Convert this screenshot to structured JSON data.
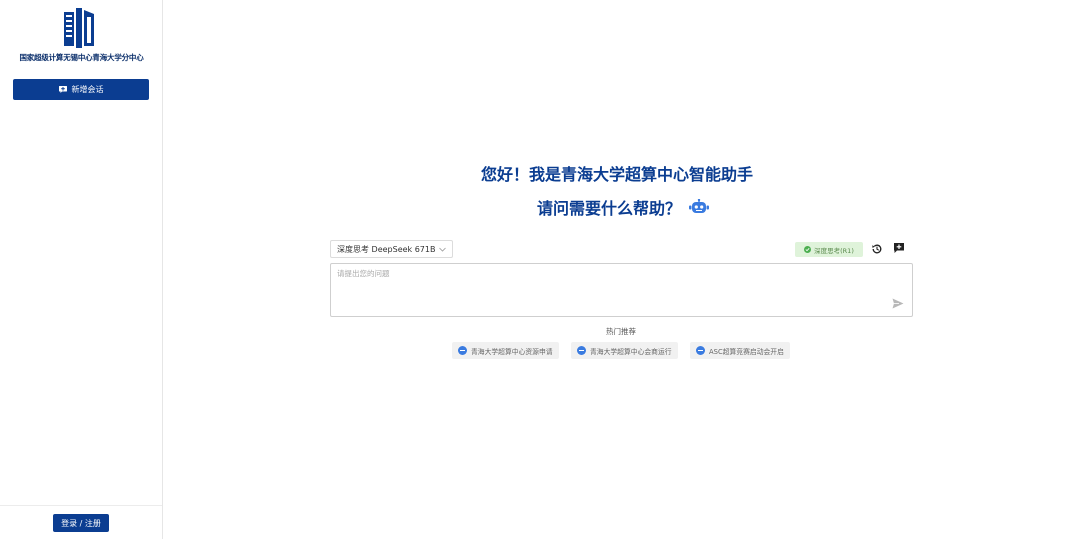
{
  "sidebar": {
    "org_name": "国家超级计算无锡中心青海大学分中心",
    "new_chat_label": "新增会话",
    "login_label": "登录 / 注册"
  },
  "welcome": {
    "line1": "您好！我是青海大学超算中心智能助手",
    "line2": "请问需要什么帮助？"
  },
  "composer": {
    "model_selected": "深度思考 DeepSeek 671B",
    "deep_think_label": "深度思考(R1)",
    "placeholder": "请提出您的问题"
  },
  "hot": {
    "title": "热门推荐",
    "items": [
      {
        "label": "青海大学超算中心资源申请"
      },
      {
        "label": "青海大学超算中心会商运行"
      },
      {
        "label": "ASC超算竞赛启动会开启"
      }
    ]
  },
  "colors": {
    "brand": "#0b3d91",
    "deep_think_bg": "#dff3da",
    "chip_bg": "#f1f1f1"
  },
  "icons": [
    "logo-icon",
    "chat-plus-icon",
    "robot-icon",
    "chevron-down-icon",
    "check-icon",
    "history-icon",
    "new-message-icon",
    "send-icon",
    "chip-icon"
  ]
}
